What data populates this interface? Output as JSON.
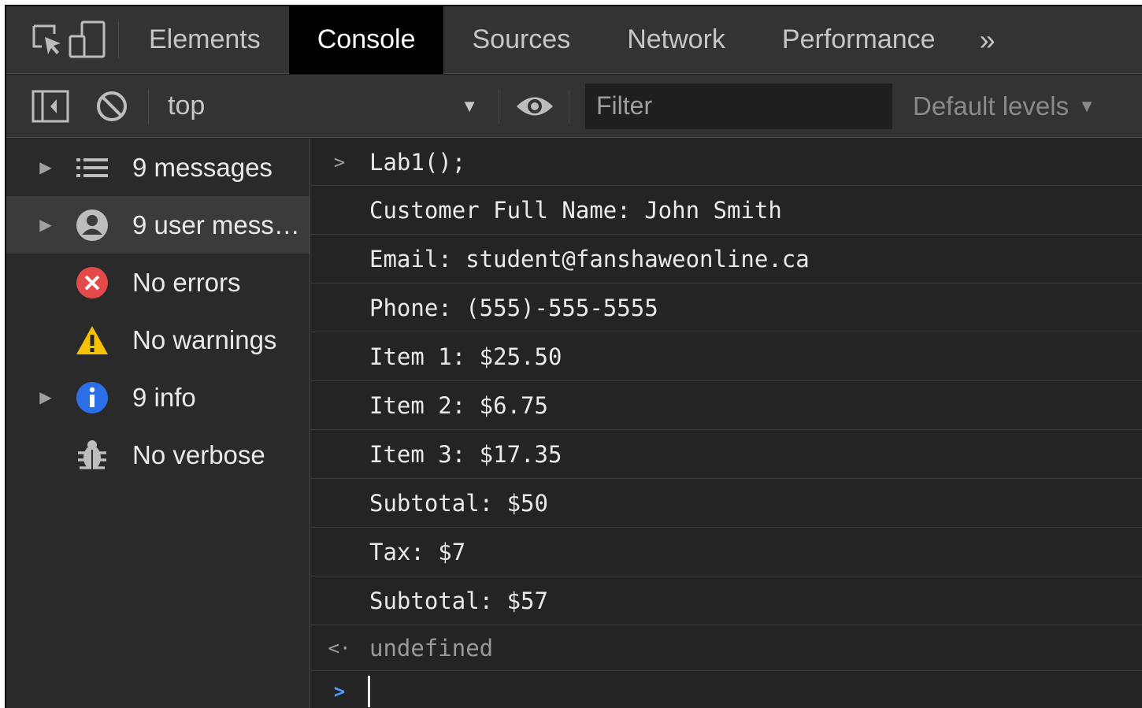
{
  "tabs": [
    {
      "label": "Elements",
      "active": false
    },
    {
      "label": "Console",
      "active": true
    },
    {
      "label": "Sources",
      "active": false
    },
    {
      "label": "Network",
      "active": false
    },
    {
      "label": "Performance",
      "active": false
    }
  ],
  "tabs_more_glyph": "»",
  "toolbar": {
    "context": "top",
    "filter_placeholder": "Filter",
    "levels_label": "Default levels"
  },
  "sidebar": {
    "items": [
      {
        "label": "9 messages",
        "icon": "list-icon",
        "expandable": true
      },
      {
        "label": "9 user mess…",
        "icon": "user-icon",
        "expandable": true
      },
      {
        "label": "No errors",
        "icon": "error-icon",
        "expandable": false
      },
      {
        "label": "No warnings",
        "icon": "warning-icon",
        "expandable": false
      },
      {
        "label": "9 info",
        "icon": "info-icon",
        "expandable": true
      },
      {
        "label": "No verbose",
        "icon": "bug-icon",
        "expandable": false
      }
    ]
  },
  "console": {
    "input": "Lab1();",
    "logs": [
      "Customer Full Name: John Smith",
      "Email: student@fanshaweonline.ca",
      "Phone: (555)-555-5555",
      "Item 1: $25.50",
      "Item 2: $6.75",
      "Item 3: $17.35",
      "Subtotal: $50",
      "Tax: $7",
      "Subtotal: $57"
    ],
    "result": "undefined"
  },
  "colors": {
    "error": "#e34b4b",
    "warning": "#f6c100",
    "info": "#2a6ee8",
    "prompt_accent": "#4c9bff"
  }
}
